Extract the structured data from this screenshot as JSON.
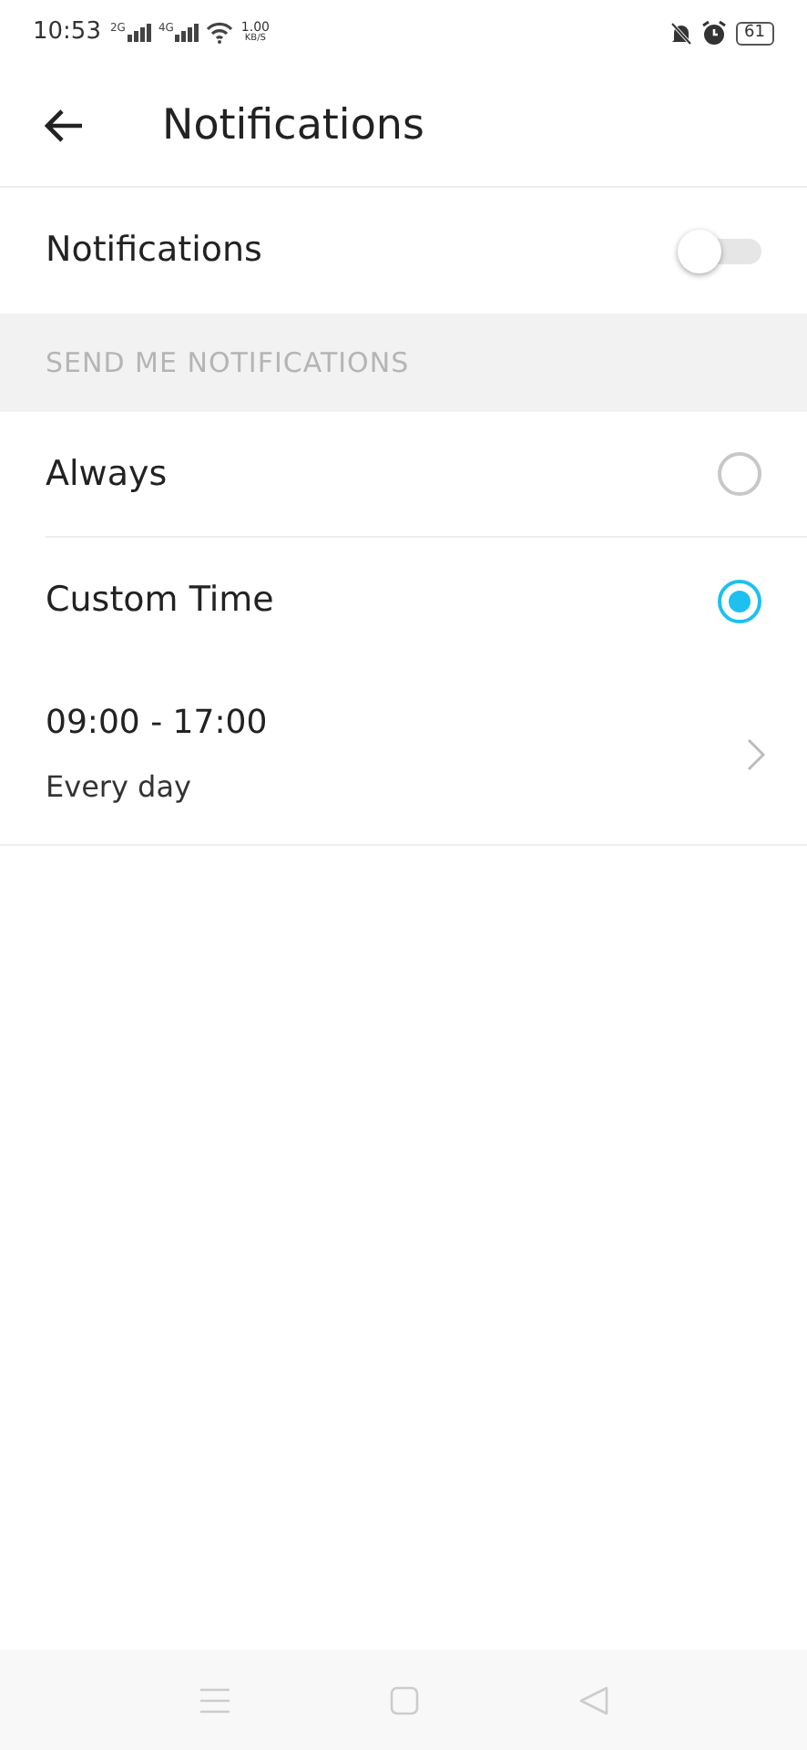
{
  "status_bar": {
    "time": "10:53",
    "sim_1": "2G",
    "sim_2": "4G",
    "speed": "1.00",
    "speed_unit": "KB/S",
    "battery": "61"
  },
  "header": {
    "title": "Notifications"
  },
  "notifications": {
    "label": "Notifications",
    "on": false
  },
  "section": {
    "title": "SEND ME NOTIFICATIONS"
  },
  "options": [
    {
      "label": "Always",
      "selected": false
    },
    {
      "label": "Custom Time",
      "selected": true
    }
  ],
  "schedule": {
    "time": "09:00 - 17:00",
    "repeat": "Every day"
  }
}
